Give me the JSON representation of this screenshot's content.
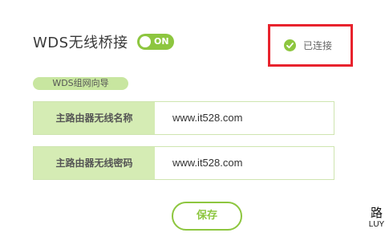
{
  "header": {
    "title": "WDS无线桥接",
    "toggle_label": "ON",
    "status_text": "已连接"
  },
  "guide": {
    "label": "WDS组网向导"
  },
  "fields": [
    {
      "label": "主路由器无线名称",
      "value": "www.it528.com"
    },
    {
      "label": "主路由器无线密码",
      "value": "www.it528.com"
    }
  ],
  "actions": {
    "save_label": "保存"
  },
  "watermark": {
    "char": "路",
    "text": "LUY"
  },
  "colors": {
    "accent": "#8dc63f",
    "highlight": "#e8232d",
    "label_bg": "#d5ecb4"
  }
}
